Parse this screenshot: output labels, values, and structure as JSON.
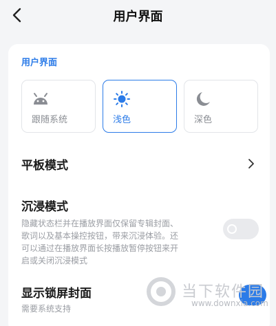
{
  "header": {
    "title": "用户界面",
    "back_icon": "chevron-left-icon"
  },
  "section_title": "用户界面",
  "theme_options": [
    {
      "label": "跟随系统",
      "icon": "android-icon",
      "selected": false
    },
    {
      "label": "浅色",
      "icon": "sun-icon",
      "selected": true
    },
    {
      "label": "深色",
      "icon": "moon-icon",
      "selected": false
    }
  ],
  "tablet_mode": {
    "label": "平板模式",
    "icon": "chevron-right-icon"
  },
  "immersive_mode": {
    "label": "沉浸模式",
    "description_lines": [
      "隐藏状态栏并在播放界面仅保留专辑封面、",
      "歌词以及基本操控按钮，带来沉浸体验。还",
      "可以通过在播放界面长按播放暂停按钮来开",
      "启或关闭沉浸模式"
    ],
    "enabled": false
  },
  "lockscreen_cover": {
    "label": "显示锁屏封面",
    "subtitle": "需要系统支持",
    "enabled": true
  },
  "watermark": {
    "brand": "当下软件园",
    "url": "www.downxia.com"
  },
  "colors": {
    "accent": "#2b7be8",
    "background": "#f4f5f7",
    "card": "#ffffff",
    "muted": "#9a9da3"
  }
}
